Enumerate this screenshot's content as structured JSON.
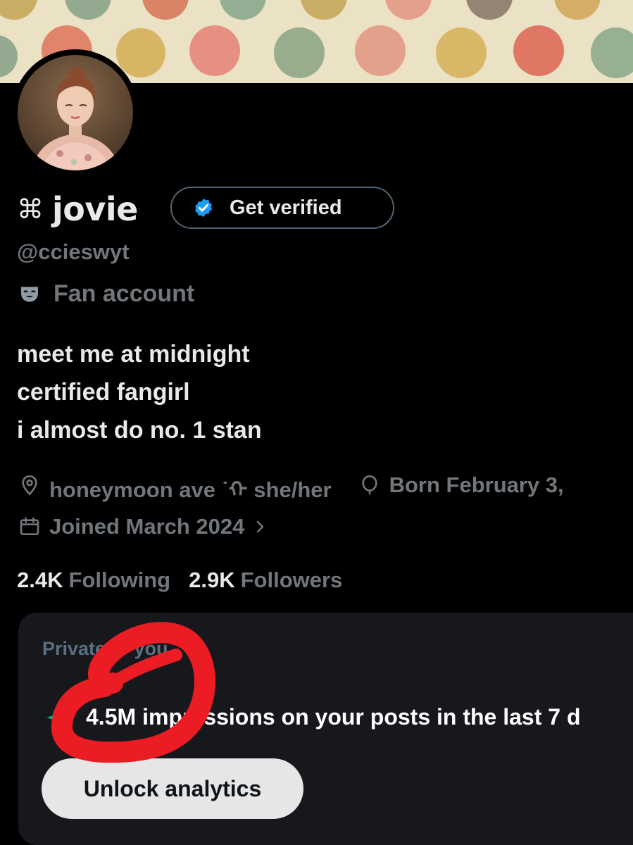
{
  "profile": {
    "name_symbol": "⌘",
    "name": "jovie",
    "verify_button_label": "Get verified",
    "handle": "@ccieswyt",
    "category": "Fan account",
    "bio_lines": [
      "meet me at midnight",
      "certified fangirl",
      "i almost do no. 1 stan"
    ],
    "location": "honeymoon ave ˙ᡣ she/her",
    "birthday": "Born February 3,",
    "joined": "Joined March 2024",
    "following_count": "2.4K",
    "following_label": "Following",
    "followers_count": "2.9K",
    "followers_label": "Followers"
  },
  "analytics_card": {
    "private_label": "Private to you",
    "impressions_value": "4.5M",
    "impressions_text": "impressions on your posts in the last 7 d",
    "unlock_button_label": "Unlock analytics"
  },
  "icons": {
    "name_symbol": "command-icon",
    "verified_badge": "verified-badge-icon",
    "category": "theater-mask-icon",
    "location": "location-pin-icon",
    "birthday": "balloon-icon",
    "joined": "calendar-icon",
    "joined_more": "chevron-right-icon",
    "impressions": "sparkle-icon"
  },
  "colors": {
    "background": "#000000",
    "primary_text": "#e7e9ea",
    "secondary_text": "#71767b",
    "verified_blue": "#1d9bf0",
    "card_background": "#16181c",
    "annotation_red": "#ec1c24"
  }
}
